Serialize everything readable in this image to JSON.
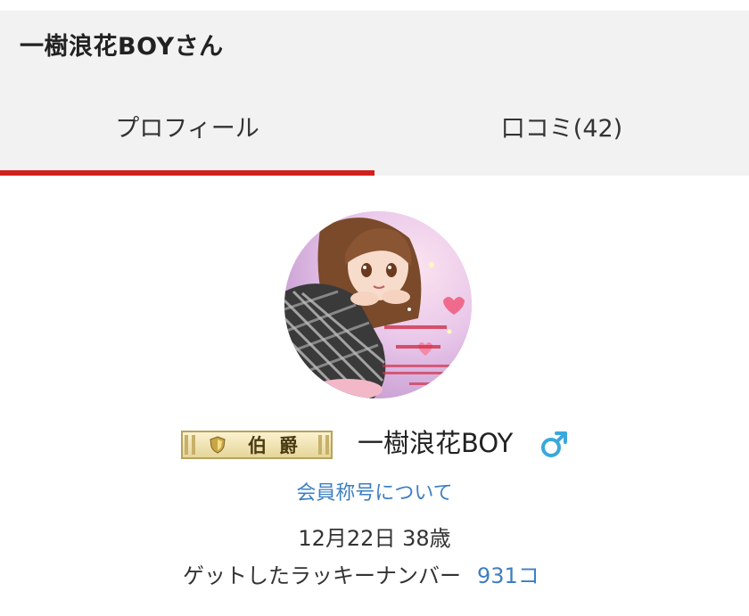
{
  "header": {
    "title": "一樹浪花BOYさん"
  },
  "tabs": [
    {
      "label": "プロフィール",
      "active": true
    },
    {
      "label": "口コミ(42)",
      "active": false
    }
  ],
  "profile": {
    "rank": "伯爵",
    "name": "一樹浪花BOY",
    "gender_icon": "male-symbol-icon",
    "member_title_link": "会員称号について",
    "birthday_age": "12月22日 38歳",
    "lucky_label": "ゲットしたラッキーナンバー",
    "lucky_count": "931コ"
  },
  "colors": {
    "accent": "#d0201d",
    "link": "#3d7fc1",
    "header_bg": "#f2f2f2",
    "gender": "#3aa8dc"
  }
}
